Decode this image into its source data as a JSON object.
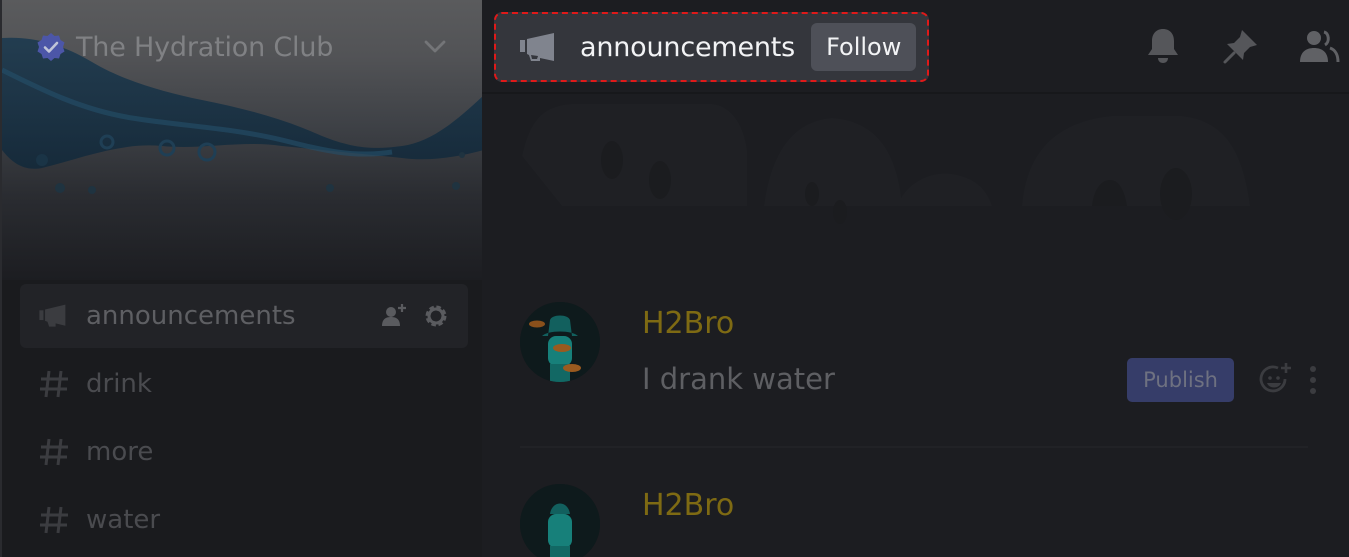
{
  "sidebar": {
    "guild": {
      "name": "The Hydration Club",
      "verified_icon": "verified-badge-icon",
      "dropdown_icon": "chevron-down-icon"
    },
    "channels": [
      {
        "name": "announcements",
        "type": "announcement",
        "icon": "megaphone-icon",
        "selected": true
      },
      {
        "name": "drink",
        "type": "text",
        "icon": "hash-icon",
        "selected": false
      },
      {
        "name": "more",
        "type": "text",
        "icon": "hash-icon",
        "selected": false
      },
      {
        "name": "water",
        "type": "text",
        "icon": "hash-icon",
        "selected": false
      }
    ],
    "channel_actions": [
      "invite-icon",
      "gear-icon"
    ]
  },
  "header": {
    "channel_name": "announcements",
    "channel_icon": "megaphone-icon",
    "follow_label": "Follow",
    "toolbar": [
      "bell-icon",
      "pin-icon",
      "members-icon"
    ]
  },
  "messages": [
    {
      "author": "H2Bro",
      "content": "I drank water",
      "publish_label": "Publish",
      "author_color": "#7e6a13"
    },
    {
      "author": "H2Bro",
      "content": "",
      "author_color": "#7e6a13"
    }
  ],
  "colors": {
    "highlight_border": "#e01919",
    "publish_bg": "#363d69",
    "verified": "#4c56a8"
  }
}
